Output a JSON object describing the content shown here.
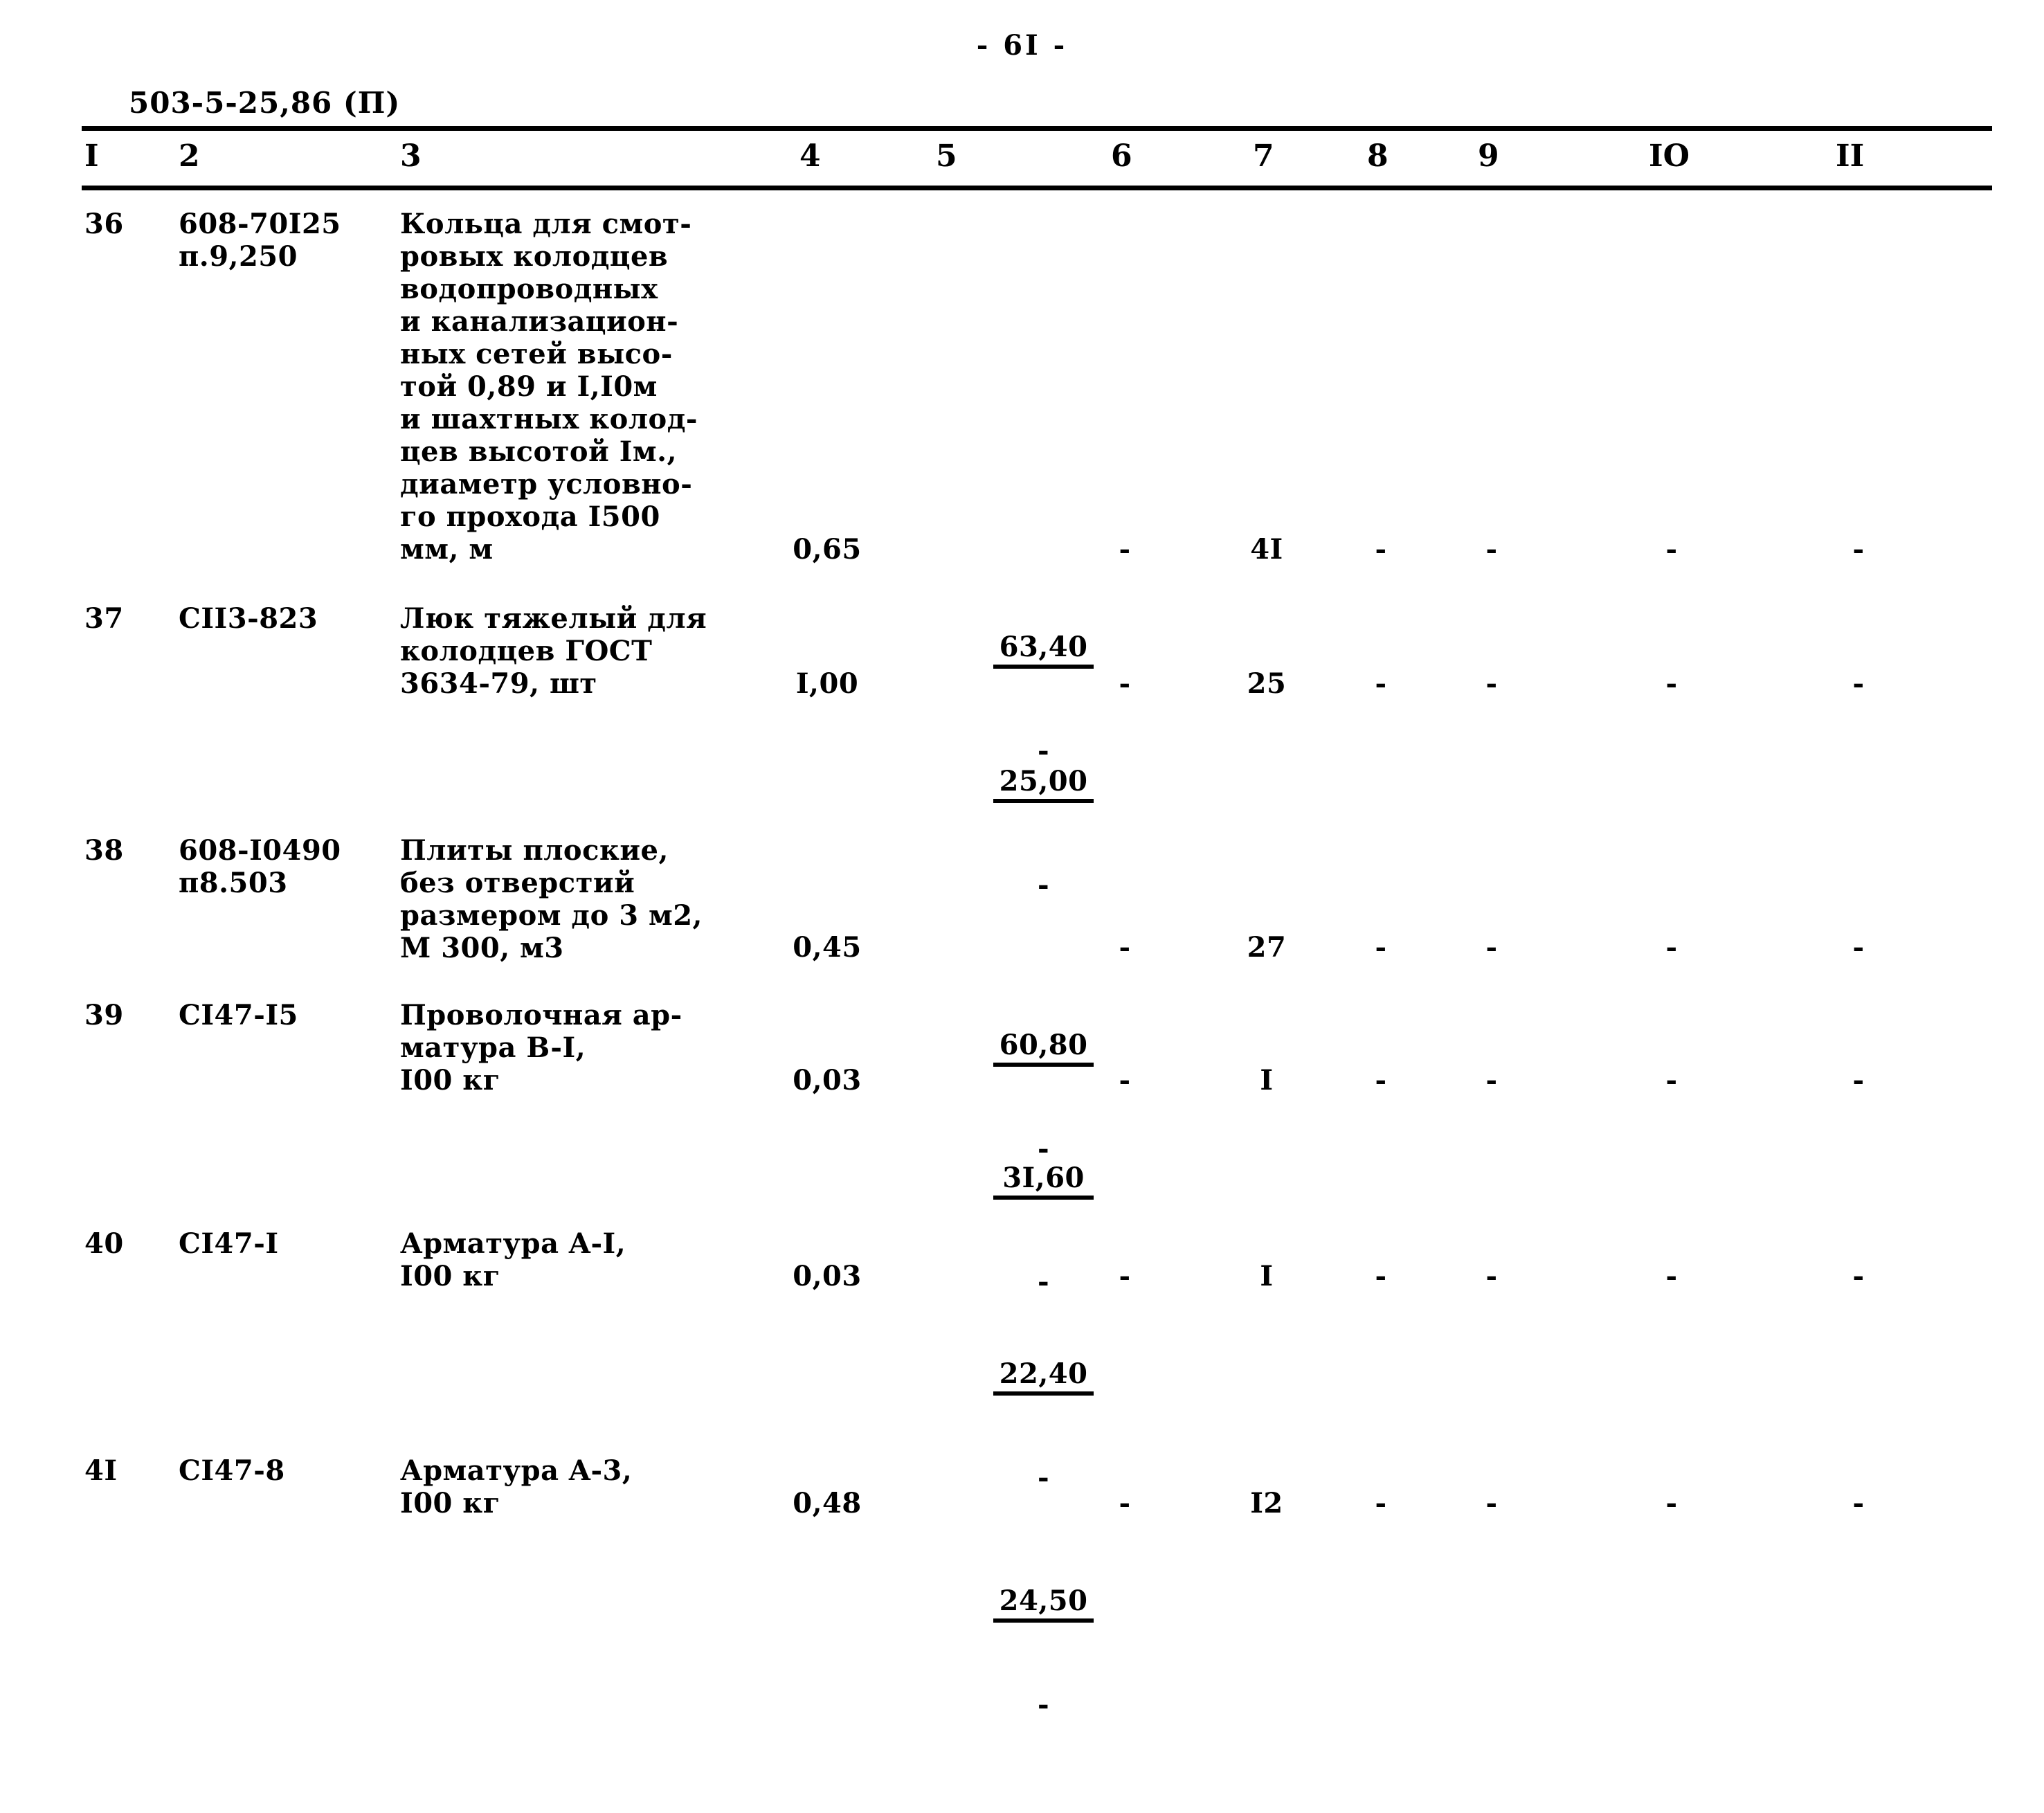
{
  "page": {
    "page_number": "- 6I -",
    "doc_code": "503-5-25,86 (П)"
  },
  "table": {
    "column_headers": [
      "I",
      "2",
      "3",
      "4",
      "5",
      "6",
      "7",
      "8",
      "9",
      "IO",
      "II"
    ],
    "rows": [
      {
        "num": "36",
        "code": "608-70I25\nп.9,250",
        "description": "Кольца для смот-\nровых колодцев\nводопроводных\nи канализацион-\nных сетей высо-\nтой 0,89 и I,I0м\nи шахтных колод-\nцев высотой Iм.,\nдиаметр условно-\nго прохода I500\nмм, м",
        "col4": "0,65",
        "col5_top": "63,40",
        "col5_bottom": "-",
        "col6": "-",
        "col7": "4I",
        "col8": "-",
        "col9": "-",
        "col10": "-",
        "col11": "-"
      },
      {
        "num": "37",
        "code": "CII3-823",
        "description": "Люк тяжелый для\nколодцев ГОСТ\n3634-79, шт",
        "col4": "I,00",
        "col5_top": "25,00",
        "col5_bottom": "-",
        "col6": "-",
        "col7": "25",
        "col8": "-",
        "col9": "-",
        "col10": "-",
        "col11": "-"
      },
      {
        "num": "38",
        "code": "608-I0490\nп8.503",
        "description": "Плиты плоские,\nбез отверстий\nразмером до 3 м2,\nМ 300, м3",
        "col4": "0,45",
        "col5_top": "60,80",
        "col5_bottom": "-",
        "col6": "-",
        "col7": "27",
        "col8": "-",
        "col9": "-",
        "col10": "-",
        "col11": "-"
      },
      {
        "num": "39",
        "code": "CI47-I5",
        "description": "Проволочная ар-\nматура B-I,\nI00 кг",
        "col4": "0,03",
        "col5_top": "3I,60",
        "col5_bottom": "-",
        "col6": "-",
        "col7": "I",
        "col8": "-",
        "col9": "-",
        "col10": "-",
        "col11": "-"
      },
      {
        "num": "40",
        "code": "CI47-I",
        "description": "Арматура A-I,\nI00 кг",
        "col4": "0,03",
        "col5_top": "22,40",
        "col5_bottom": "-",
        "col6": "-",
        "col7": "I",
        "col8": "-",
        "col9": "-",
        "col10": "-",
        "col11": "-"
      },
      {
        "num": "4I",
        "code": "CI47-8",
        "description": "Арматура A-3,\nI00 кг",
        "col4": "0,48",
        "col5_top": "24,50",
        "col5_bottom": "-",
        "col6": "-",
        "col7": "I2",
        "col8": "-",
        "col9": "-",
        "col10": "-",
        "col11": "-"
      }
    ]
  }
}
